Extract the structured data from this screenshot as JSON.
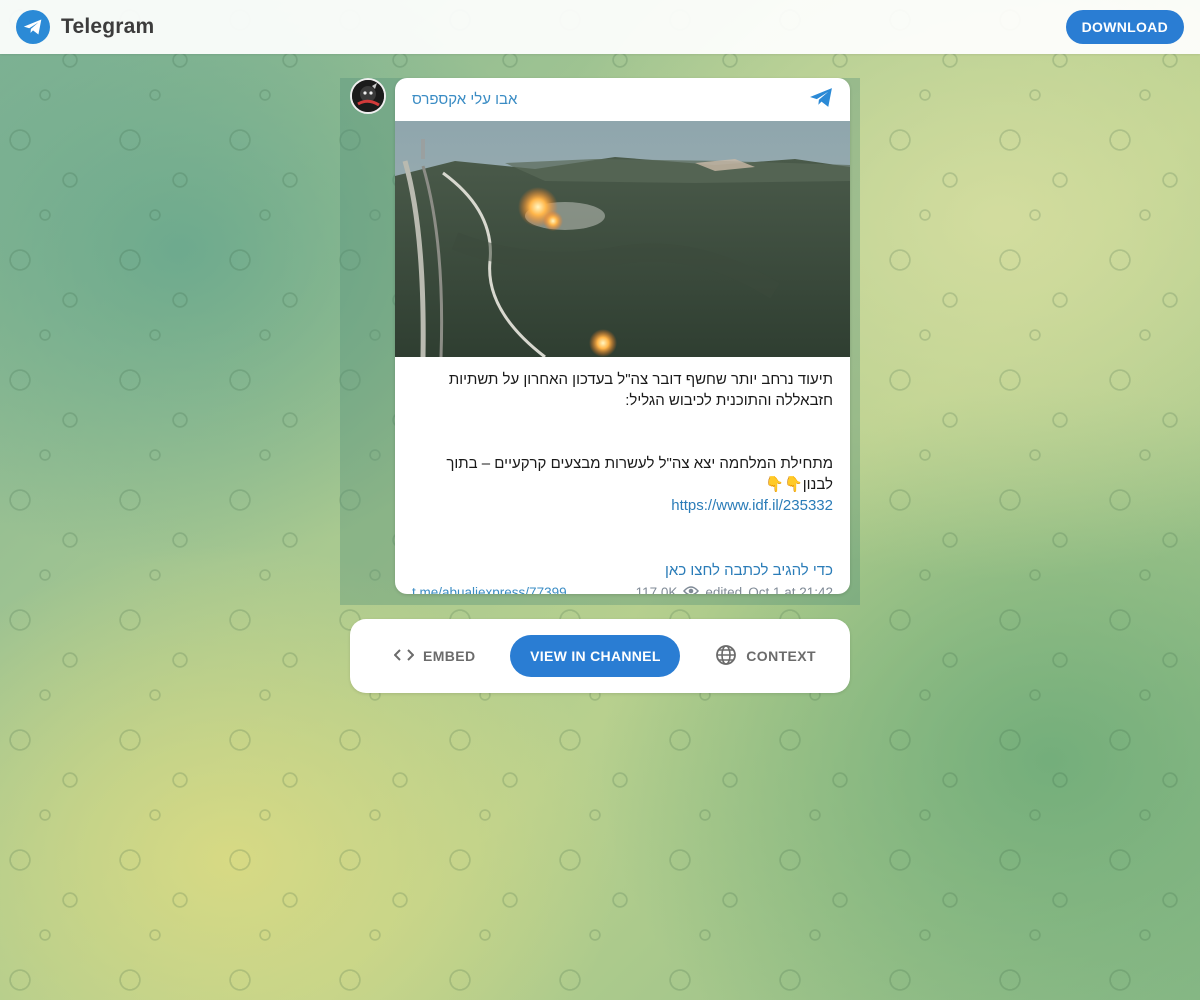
{
  "header": {
    "brand": "Telegram",
    "download_label": "DOWNLOAD",
    "accent": "#2a7dd3"
  },
  "post": {
    "channel_name": "אבו עלי אקספרס",
    "paragraph1": "תיעוד נרחב יותר שחשף דובר צה\"ל בעדכון האחרון על תשתיות חזבאללה והתוכנית לכיבוש הגליל:",
    "paragraph2": "מתחילת המלחמה יצא צה\"ל לעשרות מבצעים קרקעיים – בתוך לבנון👇👇",
    "url": "https://www.idf.il/235332",
    "reply_text": "כדי להגיב לכתבה לחצו כאן",
    "permalink": "t.me/abualiexpress/77399",
    "views": "117.0K",
    "edited": "edited",
    "date": "Oct 1 at 21:42"
  },
  "actions": {
    "embed_label": "EMBED",
    "view_label": "VIEW IN CHANNEL",
    "context_label": "CONTEXT"
  },
  "icons": {
    "brand": "telegram-logo-icon",
    "channel": "telegram-plane-icon",
    "views": "eye-icon",
    "embed": "code-icon",
    "context": "globe-icon"
  }
}
